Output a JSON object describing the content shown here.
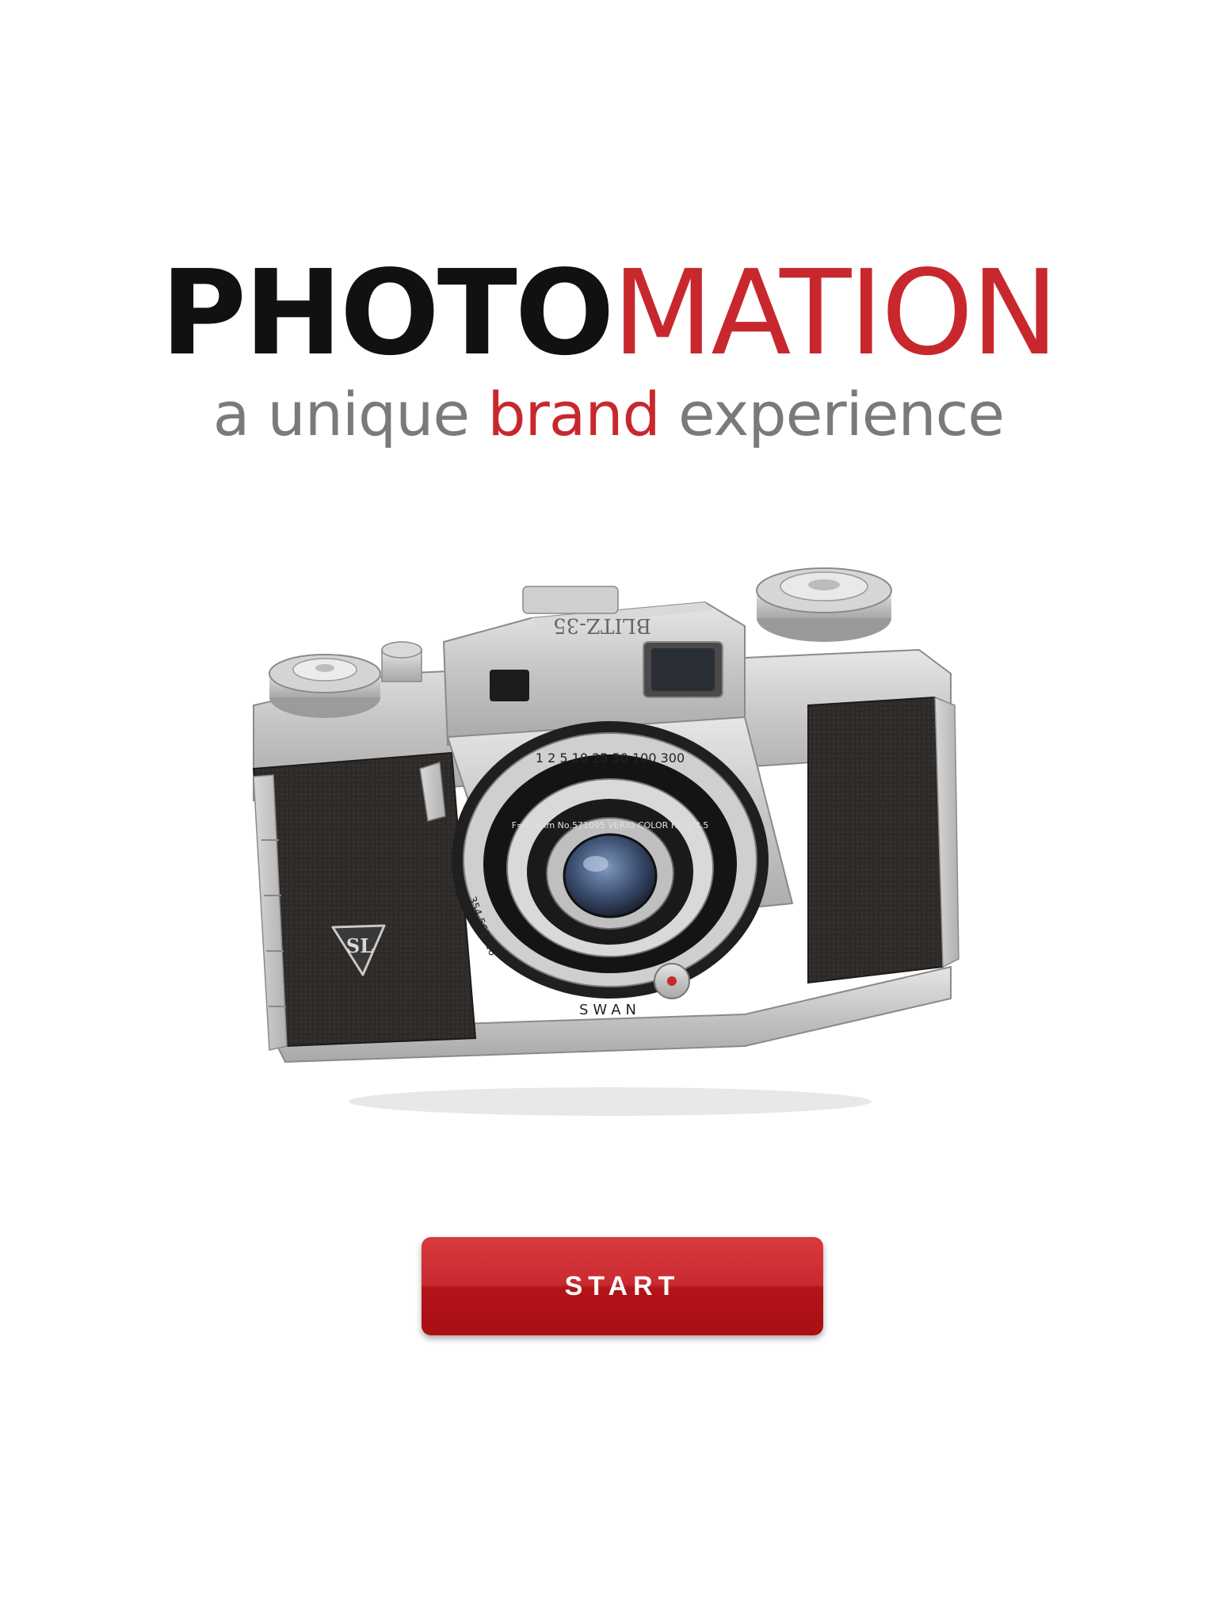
{
  "brand": {
    "logo_part_1": "PHOTO",
    "logo_part_2": "MATION",
    "tagline_before": "a unique ",
    "tagline_highlight": "brand",
    "tagline_after": " experience"
  },
  "camera": {
    "icon": "vintage-camera-icon",
    "top_plate_engraving": "BLITZ-35",
    "badge_monogram": "SL",
    "lens_text": "F=4.5mm No.571095 VERIO COLOR F.C 1:3.5",
    "lens_brand": "SWAN",
    "shutter_speeds": "1 2 5 10 25 50 100 300",
    "serial": "354 568116"
  },
  "actions": {
    "start_label": "START"
  },
  "colors": {
    "accent": "#c8282d",
    "logo_black": "#111111",
    "tagline_gray": "#7a7a7a",
    "button_red": "#c92a2f"
  }
}
